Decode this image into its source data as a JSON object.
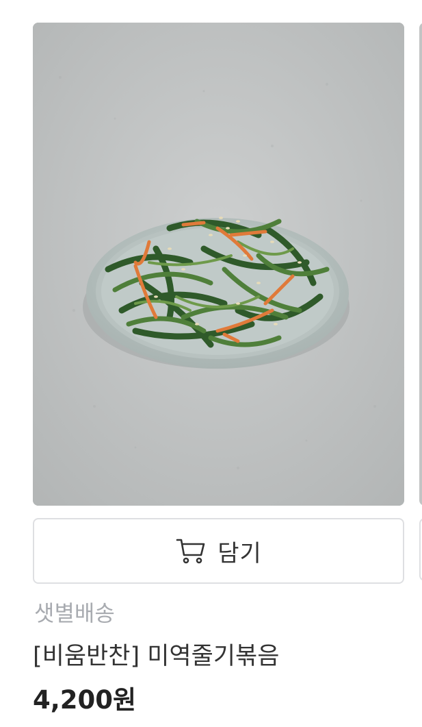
{
  "product": {
    "image_alt": "미역줄기볶음",
    "cart_button_label": "담기",
    "delivery_type": "샛별배송",
    "name": "[비움반찬] 미역줄기볶음",
    "price": "4,200원"
  },
  "icons": {
    "cart": "cart-icon"
  },
  "colors": {
    "text_primary": "#333333",
    "text_muted": "#a8abb0",
    "border": "#dedfe2",
    "background": "#ffffff"
  }
}
